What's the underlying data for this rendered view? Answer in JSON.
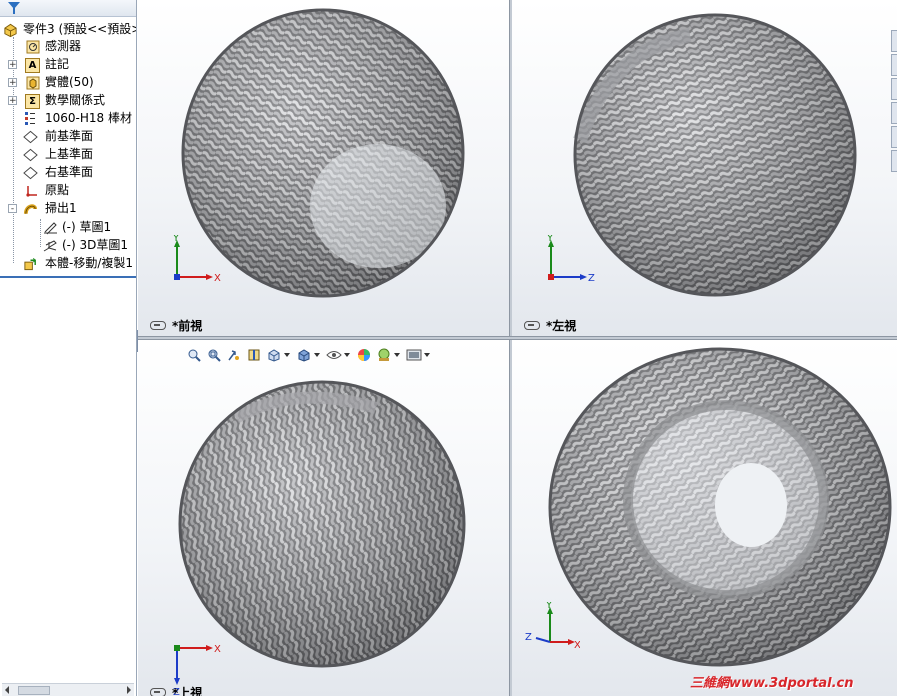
{
  "feature_tree": {
    "filter_icon": "funnel-icon",
    "part": {
      "label": "零件3 (預設<<預設>",
      "icon": "part-icon"
    },
    "items": [
      {
        "label": "感測器",
        "icon": "sensor-icon",
        "expand": ""
      },
      {
        "label": "註記",
        "icon": "annotation-icon",
        "expand": "+"
      },
      {
        "label": "實體(50)",
        "icon": "solid-bodies-icon",
        "expand": "+"
      },
      {
        "label": "數學關係式",
        "icon": "equations-icon",
        "expand": "+"
      },
      {
        "label": "1060-H18 棒材 (",
        "icon": "material-icon",
        "expand": ""
      },
      {
        "label": "前基準面",
        "icon": "plane-icon",
        "expand": ""
      },
      {
        "label": "上基準面",
        "icon": "plane-icon",
        "expand": ""
      },
      {
        "label": "右基準面",
        "icon": "plane-icon",
        "expand": ""
      },
      {
        "label": "原點",
        "icon": "origin-icon",
        "expand": ""
      },
      {
        "label": "掃出1",
        "icon": "sweep-icon",
        "expand": "-"
      },
      {
        "label": "(-) 草圖1",
        "icon": "sketch-icon",
        "expand": ""
      },
      {
        "label": "(-) 3D草圖1",
        "icon": "3d-sketch-icon",
        "expand": ""
      },
      {
        "label": "本體-移動/複製1",
        "icon": "move-copy-icon",
        "expand": ""
      }
    ]
  },
  "viewports": {
    "front": {
      "label": "*前視",
      "axes": [
        "Y",
        "X"
      ]
    },
    "left": {
      "label": "*左視",
      "axes": [
        "Y",
        "Z"
      ]
    },
    "top": {
      "label": "*上視",
      "axes": [
        "X",
        "Z"
      ]
    },
    "iso": {
      "label": "",
      "axes": [
        "Y",
        "Z",
        "X"
      ]
    }
  },
  "hud_toolbar": [
    "zoom-to-fit-icon",
    "zoom-to-area-icon",
    "previous-view-icon",
    "section-view-icon",
    "view-orientation-icon",
    "display-style-icon",
    "hide-show-items-icon",
    "edit-appearance-icon",
    "apply-scene-icon",
    "view-settings-icon"
  ],
  "watermark": "三維網www.3dportal.cn",
  "colors": {
    "tree_accent": "#3a6fb6",
    "axis_x": "#d01c1c",
    "axis_y": "#1a8a1a",
    "axis_z": "#1c3cc8",
    "watermark": "#d8262b"
  }
}
